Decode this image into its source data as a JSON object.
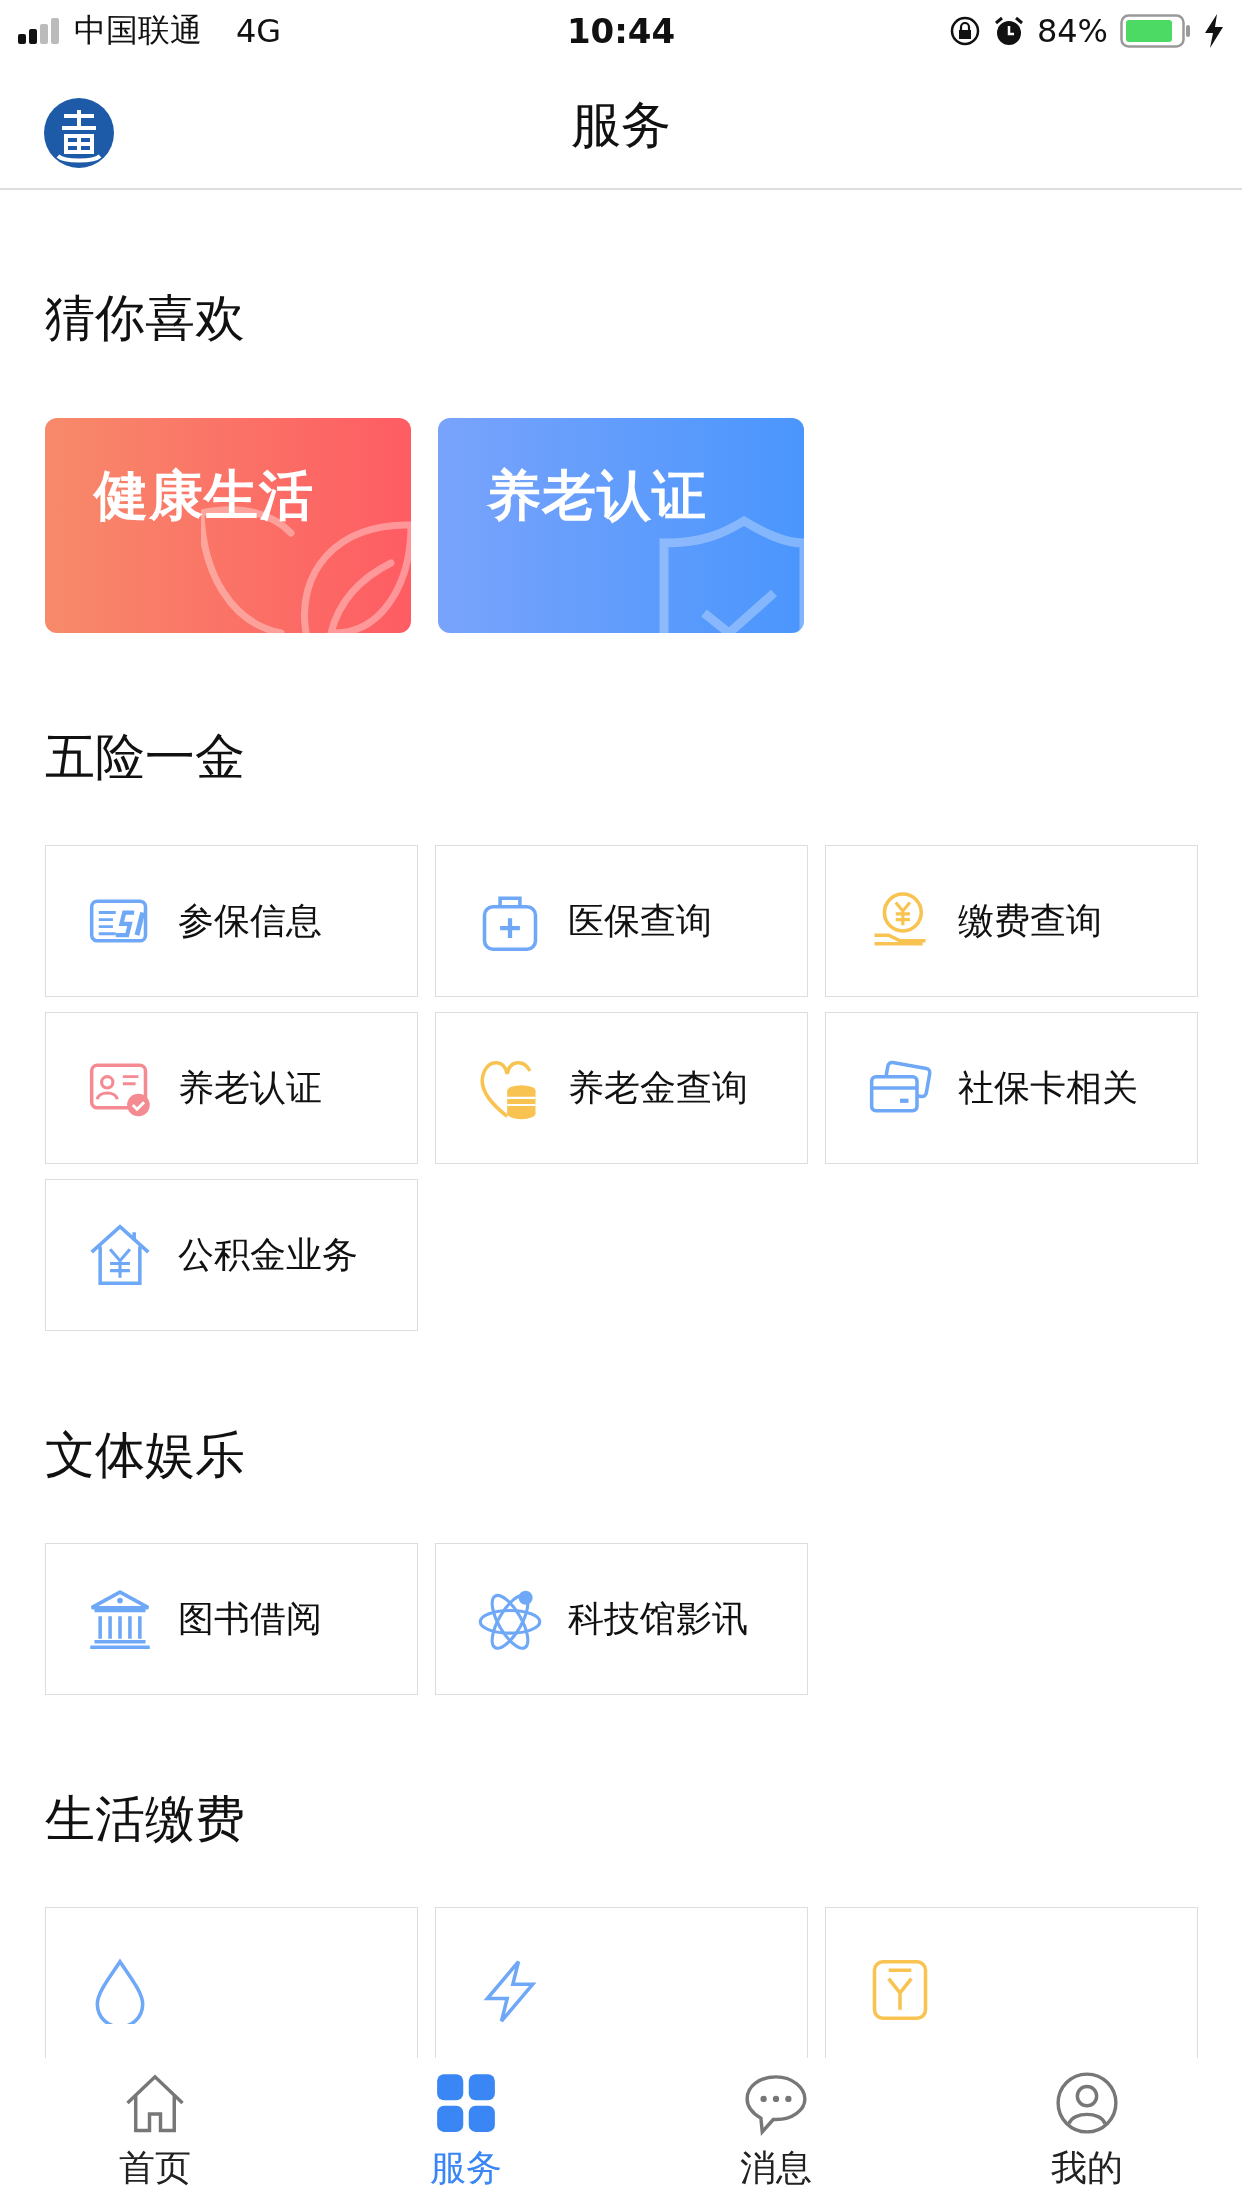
{
  "status_bar": {
    "carrier": "中国联通",
    "network": "4G",
    "time": "10:44",
    "battery": "84%"
  },
  "header": {
    "title": "服务"
  },
  "sections": [
    {
      "title": "猜你喜欢",
      "kind": "banners",
      "items": [
        {
          "label": "健康生活",
          "kind": "health"
        },
        {
          "label": "养老认证",
          "kind": "pension"
        }
      ]
    },
    {
      "title": "五险一金",
      "kind": "grid",
      "items": [
        {
          "label": "参保信息"
        },
        {
          "label": "医保查询"
        },
        {
          "label": "缴费查询"
        },
        {
          "label": "养老认证"
        },
        {
          "label": "养老金查询"
        },
        {
          "label": "社保卡相关"
        },
        {
          "label": "公积金业务"
        }
      ]
    },
    {
      "title": "文体娱乐",
      "kind": "grid",
      "items": [
        {
          "label": "图书借阅"
        },
        {
          "label": "科技馆影讯"
        }
      ]
    },
    {
      "title": "生活缴费",
      "kind": "grid",
      "items": [
        {
          "kind": "partial"
        },
        {
          "kind": "partial"
        },
        {
          "kind": "partial"
        }
      ]
    }
  ],
  "tabs": [
    {
      "label": "首页",
      "selected": false
    },
    {
      "label": "服务",
      "selected": true
    },
    {
      "label": "消息",
      "selected": false
    },
    {
      "label": "我的",
      "selected": false
    }
  ]
}
